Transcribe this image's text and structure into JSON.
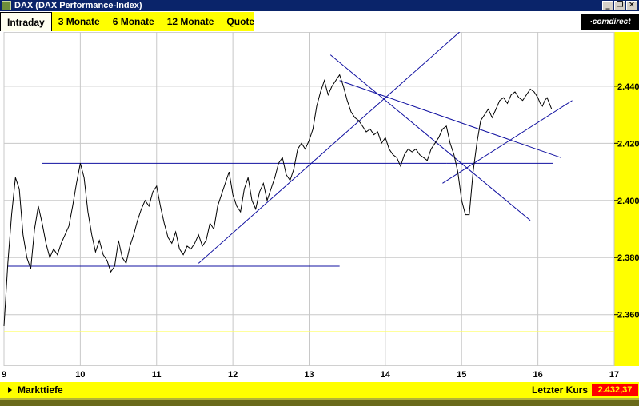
{
  "window": {
    "title": "DAX (DAX Performance-Index)",
    "minimize": "_",
    "restore": "❐",
    "close": "✕"
  },
  "tabs": [
    {
      "label": "Intraday",
      "active": true
    },
    {
      "label": "3 Monate",
      "active": false
    },
    {
      "label": "6 Monate",
      "active": false
    },
    {
      "label": "12 Monate",
      "active": false
    },
    {
      "label": "Quote",
      "active": false
    }
  ],
  "brand": "·comdirect",
  "footer": {
    "markttiefe": "Markttiefe",
    "letzter_kurs_label": "Letzter Kurs",
    "letzter_kurs_value": "2.432,37"
  },
  "colors": {
    "accent_yellow": "#ffff00",
    "trendline": "#1010a0",
    "price_line": "#000000",
    "reference_line": "#ffff60",
    "last_price_bg": "#ff0000"
  },
  "chart_data": {
    "type": "line",
    "title": "",
    "xlabel": "",
    "ylabel": "",
    "x_ticks": [
      "9",
      "10",
      "11",
      "12",
      "13",
      "14",
      "15",
      "16",
      "17"
    ],
    "y_ticks": [
      "2.360",
      "2.380",
      "2.400",
      "2.420",
      "2.440"
    ],
    "xlim": [
      9,
      17
    ],
    "ylim": [
      2342,
      2459
    ],
    "grid": true,
    "reference_line": 2.354,
    "series": [
      {
        "x": [
          9.0,
          9.05,
          9.1,
          9.15,
          9.2,
          9.25,
          9.3,
          9.35,
          9.4,
          9.45,
          9.5,
          9.55,
          9.6,
          9.65,
          9.7,
          9.75,
          9.8,
          9.85,
          9.9,
          9.95,
          10.0,
          10.05,
          10.1,
          10.15,
          10.2,
          10.25,
          10.3,
          10.35,
          10.4,
          10.45,
          10.5,
          10.55,
          10.6,
          10.65,
          10.7,
          10.75,
          10.8,
          10.85,
          10.9,
          10.95,
          11.0,
          11.05,
          11.1,
          11.15,
          11.2,
          11.25,
          11.3,
          11.35,
          11.4,
          11.45,
          11.5,
          11.55,
          11.6,
          11.65,
          11.7,
          11.75,
          11.8,
          11.85,
          11.9,
          11.95,
          12.0,
          12.05,
          12.1,
          12.15,
          12.2,
          12.25,
          12.3,
          12.35,
          12.4,
          12.45,
          12.5,
          12.55,
          12.6,
          12.65,
          12.7,
          12.75,
          12.8,
          12.85,
          12.9,
          12.95,
          13.0,
          13.05,
          13.1,
          13.15,
          13.2,
          13.25,
          13.3,
          13.35,
          13.4,
          13.45,
          13.5,
          13.55,
          13.6,
          13.65,
          13.7,
          13.75,
          13.8,
          13.85,
          13.9,
          13.95,
          14.0,
          14.05,
          14.1,
          14.15,
          14.2,
          14.25,
          14.3,
          14.35,
          14.4,
          14.45,
          14.5,
          14.55,
          14.6,
          14.65,
          14.7,
          14.75,
          14.8,
          14.85,
          14.9,
          14.95,
          15.0,
          15.05,
          15.1,
          15.15,
          15.2,
          15.25,
          15.3,
          15.35,
          15.4,
          15.45,
          15.5,
          15.55,
          15.6,
          15.65,
          15.7,
          15.75,
          15.8,
          15.85,
          15.9,
          15.95,
          16.0,
          16.03,
          16.06,
          16.09,
          16.12,
          16.15,
          16.18
        ],
        "y": [
          2356,
          2378,
          2395,
          2408,
          2404,
          2388,
          2380,
          2376,
          2390,
          2398,
          2392,
          2385,
          2380,
          2383,
          2381,
          2385,
          2388,
          2391,
          2398,
          2406,
          2413,
          2408,
          2396,
          2388,
          2382,
          2386,
          2381,
          2379,
          2375,
          2377,
          2386,
          2380,
          2378,
          2384,
          2388,
          2393,
          2397,
          2400,
          2398,
          2403,
          2405,
          2398,
          2392,
          2387,
          2385,
          2389,
          2383,
          2381,
          2384,
          2383,
          2385,
          2388,
          2384,
          2386,
          2392,
          2390,
          2398,
          2402,
          2406,
          2410,
          2402,
          2398,
          2396,
          2404,
          2408,
          2400,
          2397,
          2403,
          2406,
          2400,
          2404,
          2408,
          2413,
          2415,
          2409,
          2407,
          2411,
          2418,
          2420,
          2418,
          2421,
          2425,
          2433,
          2438,
          2442,
          2437,
          2440,
          2442,
          2444,
          2440,
          2435,
          2431,
          2429,
          2428,
          2426,
          2424,
          2425,
          2423,
          2424,
          2420,
          2422,
          2418,
          2416,
          2415,
          2412,
          2416,
          2418,
          2417,
          2418,
          2416,
          2415,
          2414,
          2418,
          2420,
          2422,
          2425,
          2426,
          2420,
          2416,
          2410,
          2400,
          2395,
          2395,
          2410,
          2420,
          2428,
          2430,
          2432,
          2429,
          2432,
          2435,
          2436,
          2434,
          2437,
          2438,
          2436,
          2435,
          2437,
          2439,
          2438,
          2436,
          2434,
          2433,
          2435,
          2436,
          2434,
          2432
        ]
      }
    ]
  }
}
